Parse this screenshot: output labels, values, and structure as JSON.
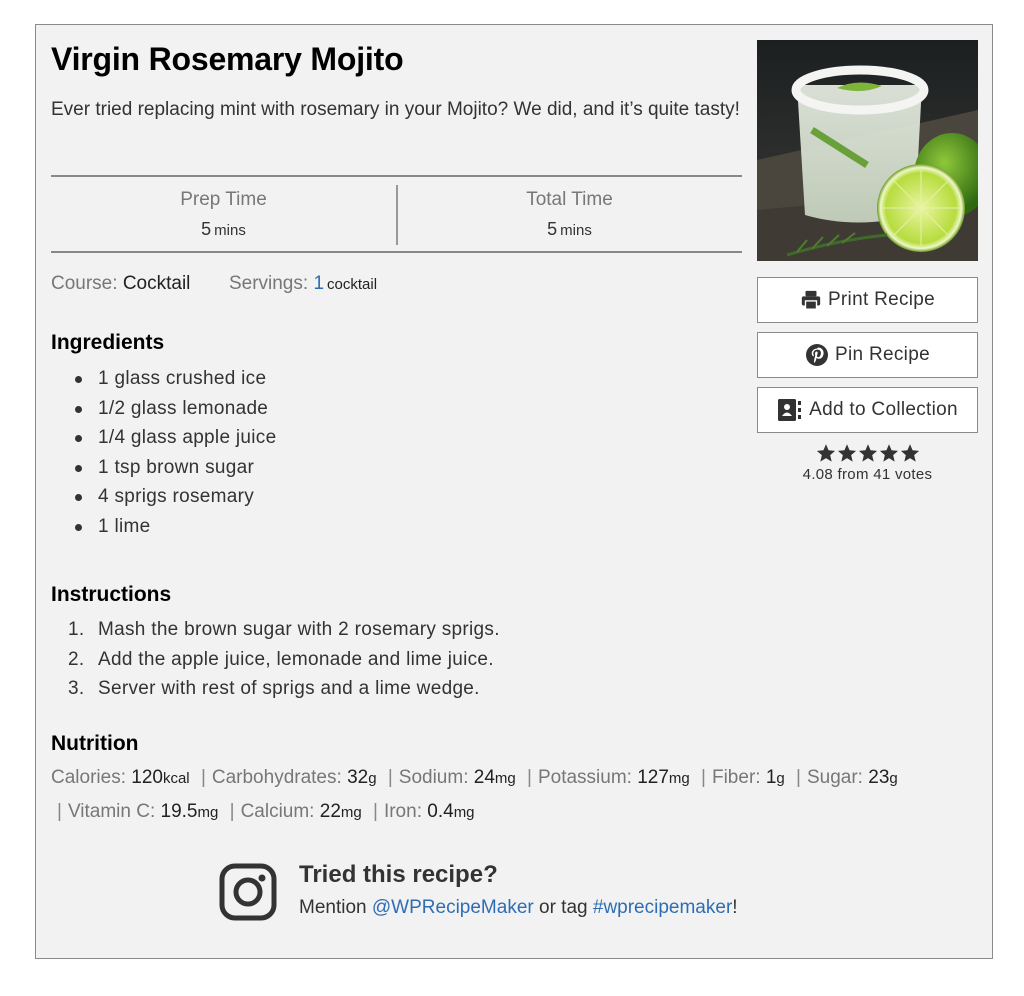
{
  "recipe": {
    "title": "Virgin Rosemary Mojito",
    "summary": "Ever tried replacing mint with rosemary in your Mojito? We did, and it’s quite tasty!",
    "image_alt": "Virgin rosemary mojito in a sugar-rimmed glass with limes and rosemary"
  },
  "times": {
    "prep": {
      "label": "Prep Time",
      "value": "5",
      "unit": "mins"
    },
    "total": {
      "label": "Total Time",
      "value": "5",
      "unit": "mins"
    }
  },
  "meta": {
    "course_label": "Course:",
    "course_value": "Cocktail",
    "servings_label": "Servings:",
    "servings_value": "1",
    "servings_unit": "cocktail"
  },
  "buttons": {
    "print": "Print Recipe",
    "pin": "Pin Recipe",
    "collection": "Add to Collection"
  },
  "rating": {
    "average": 4.08,
    "max": 5,
    "text": "4.08 from 41 votes",
    "star_color": "#333333"
  },
  "ingredients": {
    "heading": "Ingredients",
    "items": [
      "1 glass crushed ice",
      "1/2 glass lemonade",
      "1/4 glass apple juice",
      "1 tsp brown sugar",
      "4 sprigs rosemary",
      "1 lime"
    ]
  },
  "instructions": {
    "heading": "Instructions",
    "steps": [
      {
        "num": "1.",
        "text": "Mash the brown sugar with 2 rosemary sprigs."
      },
      {
        "num": "2.",
        "text": "Add the apple juice, lemonade and lime juice."
      },
      {
        "num": "3.",
        "text": "Server with rest of sprigs and a lime wedge."
      }
    ]
  },
  "nutrition": {
    "heading": "Nutrition",
    "separator": "|",
    "items": [
      {
        "label": "Calories:",
        "value": "120",
        "unit": "kcal"
      },
      {
        "label": "Carbohydrates:",
        "value": "32",
        "unit": "g"
      },
      {
        "label": "Sodium:",
        "value": "24",
        "unit": "mg"
      },
      {
        "label": "Potassium:",
        "value": "127",
        "unit": "mg"
      },
      {
        "label": "Fiber:",
        "value": "1",
        "unit": "g"
      },
      {
        "label": "Sugar:",
        "value": "23",
        "unit": "g"
      },
      {
        "label": "Vitamin C:",
        "value": "19.5",
        "unit": "mg"
      },
      {
        "label": "Calcium:",
        "value": "22",
        "unit": "mg"
      },
      {
        "label": "Iron:",
        "value": "0.4",
        "unit": "mg"
      }
    ]
  },
  "cta": {
    "title": "Tried this recipe?",
    "mention_prefix": "Mention",
    "handle": "@WPRecipeMaker",
    "middle": "or tag",
    "hashtag": "#wprecipemaker",
    "suffix": "!",
    "link_color": "#2e6db4"
  },
  "icons": {
    "print": "printer-icon",
    "pin": "pinterest-icon",
    "collection": "address-book-icon",
    "cta": "instagram-icon",
    "star": "star-icon"
  }
}
